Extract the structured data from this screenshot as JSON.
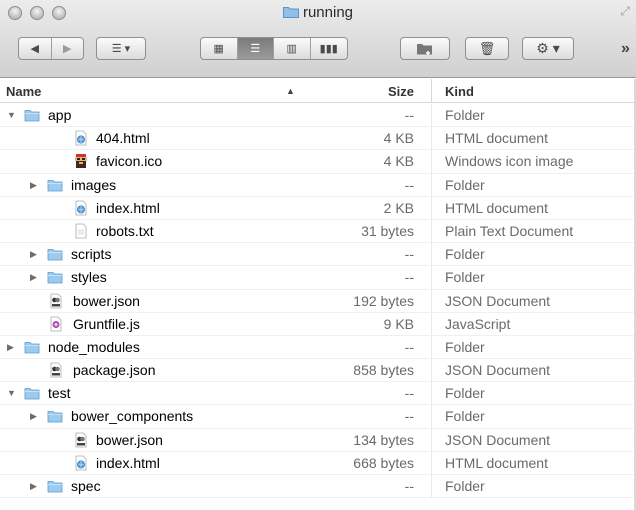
{
  "window": {
    "title": "running"
  },
  "toolbar": {
    "back_icon": "chevron-left-icon",
    "forward_icon": "chevron-right-icon",
    "arrange_icon": "list-arrange-icon",
    "view_icons": "icon-view-icon",
    "view_list": "list-view-icon",
    "view_columns": "column-view-icon",
    "view_coverflow": "coverflow-view-icon",
    "new_folder_icon": "new-folder-icon",
    "trash_icon": "trash-icon",
    "action_icon": "gear-icon",
    "overflow": "»"
  },
  "columns": {
    "name": "Name",
    "size": "Size",
    "kind": "Kind",
    "sort_indicator": "▲"
  },
  "rows": [
    {
      "name": "app",
      "size": "--",
      "kind": "Folder",
      "level": 0,
      "expander": "open",
      "icon": "folder"
    },
    {
      "name": "404.html",
      "size": "4 KB",
      "kind": "HTML document",
      "level": 1,
      "expander": "none",
      "icon": "html"
    },
    {
      "name": "favicon.ico",
      "size": "4 KB",
      "kind": "Windows icon image",
      "level": 1,
      "expander": "none",
      "icon": "ico"
    },
    {
      "name": "images",
      "size": "--",
      "kind": "Folder",
      "level": 1,
      "expander": "closed",
      "icon": "folder"
    },
    {
      "name": "index.html",
      "size": "2 KB",
      "kind": "HTML document",
      "level": 1,
      "expander": "none",
      "icon": "html"
    },
    {
      "name": "robots.txt",
      "size": "31 bytes",
      "kind": "Plain Text Document",
      "level": 1,
      "expander": "none",
      "icon": "txt"
    },
    {
      "name": "scripts",
      "size": "--",
      "kind": "Folder",
      "level": 1,
      "expander": "closed",
      "icon": "folder"
    },
    {
      "name": "styles",
      "size": "--",
      "kind": "Folder",
      "level": 1,
      "expander": "closed",
      "icon": "folder"
    },
    {
      "name": "bower.json",
      "size": "192 bytes",
      "kind": "JSON Document",
      "level": 0,
      "expander": "none",
      "icon": "json"
    },
    {
      "name": "Gruntfile.js",
      "size": "9 KB",
      "kind": "JavaScript",
      "level": 0,
      "expander": "none",
      "icon": "js"
    },
    {
      "name": "node_modules",
      "size": "--",
      "kind": "Folder",
      "level": 0,
      "expander": "closed",
      "icon": "folder"
    },
    {
      "name": "package.json",
      "size": "858 bytes",
      "kind": "JSON Document",
      "level": 0,
      "expander": "none",
      "icon": "json"
    },
    {
      "name": "test",
      "size": "--",
      "kind": "Folder",
      "level": 0,
      "expander": "open",
      "icon": "folder"
    },
    {
      "name": "bower_components",
      "size": "--",
      "kind": "Folder",
      "level": 1,
      "expander": "closed",
      "icon": "folder"
    },
    {
      "name": "bower.json",
      "size": "134 bytes",
      "kind": "JSON Document",
      "level": 1,
      "expander": "none",
      "icon": "json"
    },
    {
      "name": "index.html",
      "size": "668 bytes",
      "kind": "HTML document",
      "level": 1,
      "expander": "none",
      "icon": "html"
    },
    {
      "name": "spec",
      "size": "--",
      "kind": "Folder",
      "level": 1,
      "expander": "closed",
      "icon": "folder"
    }
  ]
}
